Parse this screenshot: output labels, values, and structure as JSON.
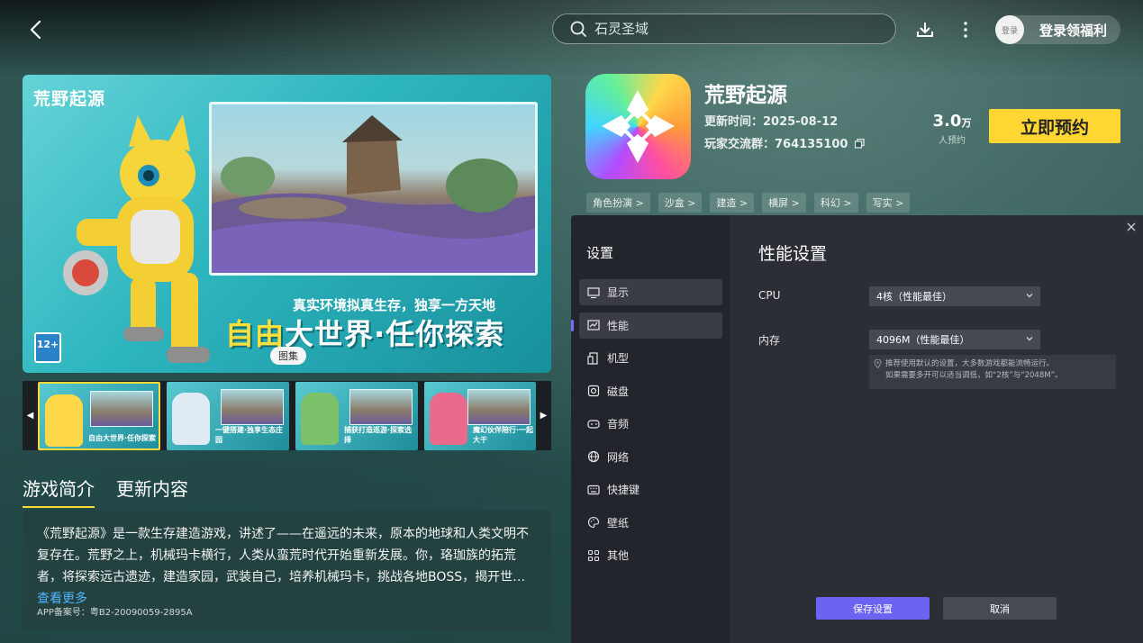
{
  "search": {
    "placeholder": "石灵圣域"
  },
  "login": {
    "avatar_text": "登录",
    "label": "登录领福利"
  },
  "hero": {
    "logo_text": "荒野起源",
    "slogan_small": "真实环境拟真生存，独享一方天地",
    "slogan_highlight": "自由",
    "slogan_rest": "大世界·任你探索",
    "age_rating": "12+",
    "gallery_label": "图集"
  },
  "thumbs": [
    {
      "caption": "自由大世界·任你探索",
      "color": "#ffd84a"
    },
    {
      "caption": "一键搭建·独享生态庄园",
      "color": "#dfeaf2"
    },
    {
      "caption": "捕获打造巡游·探索选择",
      "color": "#7cc26a"
    },
    {
      "caption": "魔幻伙伴陪行·一起大干",
      "color": "#e96a8a"
    }
  ],
  "tabs": {
    "intro": "游戏简介",
    "updates": "更新内容"
  },
  "description": {
    "text": "《荒野起源》是一款生存建造游戏，讲述了——在遥远的未来，原本的地球和人类文明不复存在。荒野之上，机械玛卡横行，人类从蛮荒时代开始重新发展。你，珞珈族的拓荒者，将探索远古遗迹，建造家园，武装自己，培养机械玛卡，挑战各地BOSS，揭开世…",
    "more": "查看更多",
    "icp": "APP备案号：粤B2-20090059-2895A"
  },
  "game": {
    "name": "荒野起源",
    "update_time": "更新时间：2025-08-12",
    "group": "玩家交流群：764135100",
    "count_num": "3.0",
    "count_unit": "万",
    "count_label": "人预约",
    "reserve_label": "立即预约",
    "tags": [
      "角色扮演 >",
      "沙盒 >",
      "建造 >",
      "横屏 >",
      "科幻 >",
      "写实 >"
    ]
  },
  "settings": {
    "title": "设置",
    "menu": [
      {
        "label": "显示",
        "icon": "monitor-icon"
      },
      {
        "label": "性能",
        "icon": "performance-icon"
      },
      {
        "label": "机型",
        "icon": "device-icon"
      },
      {
        "label": "磁盘",
        "icon": "disk-icon"
      },
      {
        "label": "音频",
        "icon": "audio-icon"
      },
      {
        "label": "网络",
        "icon": "globe-icon"
      },
      {
        "label": "快捷键",
        "icon": "keyboard-icon"
      },
      {
        "label": "壁纸",
        "icon": "palette-icon"
      },
      {
        "label": "其他",
        "icon": "grid-icon"
      }
    ],
    "panel_title": "性能设置",
    "cpu_label": "CPU",
    "cpu_value": "4核（性能最佳）",
    "memory_label": "内存",
    "memory_value": "4096M（性能最佳）",
    "hint_line1": "推荐使用默认的设置，大多数游戏都能流畅运行。",
    "hint_line2": "如果需要多开可以适当调低，如“2核”与“2048M”。",
    "save_label": "保存设置",
    "cancel_label": "取消"
  },
  "colors": {
    "accent": "#6c63f2",
    "reserve": "#ffd632",
    "link": "#4fb6ff"
  }
}
